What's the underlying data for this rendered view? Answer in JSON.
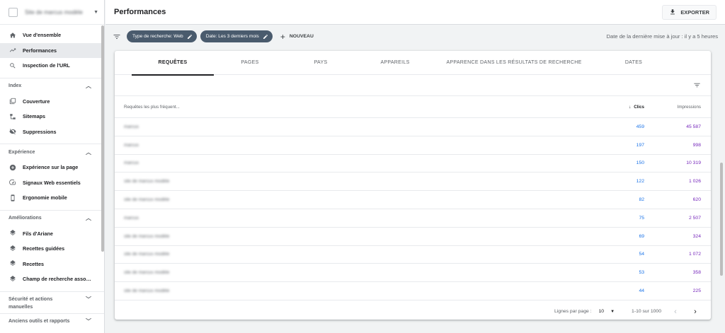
{
  "sidebar": {
    "property": "Site de marcus modèle",
    "nav": [
      {
        "label": "Vue d'ensemble",
        "icon": "home-icon"
      },
      {
        "label": "Performances",
        "icon": "trending-icon"
      },
      {
        "label": "Inspection de l'URL",
        "icon": "search-icon"
      }
    ],
    "sections": [
      {
        "title": "Index",
        "items": [
          {
            "label": "Couverture",
            "icon": "coverage-icon"
          },
          {
            "label": "Sitemaps",
            "icon": "sitemap-icon"
          },
          {
            "label": "Suppressions",
            "icon": "eye-off-icon"
          }
        ]
      },
      {
        "title": "Expérience",
        "items": [
          {
            "label": "Expérience sur la page",
            "icon": "plus-circle-icon"
          },
          {
            "label": "Signaux Web essentiels",
            "icon": "speed-icon"
          },
          {
            "label": "Ergonomie mobile",
            "icon": "phone-icon"
          }
        ]
      },
      {
        "title": "Améliorations",
        "items": [
          {
            "label": "Fils d'Ariane",
            "icon": "layers-icon"
          },
          {
            "label": "Recettes guidées",
            "icon": "layers-icon"
          },
          {
            "label": "Recettes",
            "icon": "layers-icon"
          },
          {
            "label": "Champ de recherche associé aux liens sitelink",
            "icon": "layers-icon"
          }
        ]
      },
      {
        "title": "Sécurité et actions manuelles"
      },
      {
        "title": "Anciens outils et rapports"
      }
    ]
  },
  "header": {
    "title": "Performances",
    "export_label": "EXPORTER"
  },
  "filters": {
    "chips": [
      "Type de recherche: Web",
      "Date: Les 3 derniers mois"
    ],
    "new_label": "NOUVEAU",
    "last_update": "Date de la dernière mise à jour : il y a 5 heures"
  },
  "tabs": [
    "REQUÊTES",
    "PAGES",
    "PAYS",
    "APPAREILS",
    "APPARENCE DANS LES RÉSULTATS DE RECHERCHE",
    "DATES"
  ],
  "table": {
    "headers": {
      "query": "Requêtes les plus fréquent...",
      "clicks": "Clics",
      "impressions": "Impressions"
    },
    "rows": [
      {
        "query": "marcus",
        "clicks": "459",
        "impressions": "45 587"
      },
      {
        "query": "marcus",
        "clicks": "197",
        "impressions": "998"
      },
      {
        "query": "marcus",
        "clicks": "150",
        "impressions": "10 319"
      },
      {
        "query": "site de marcus modèle",
        "clicks": "122",
        "impressions": "1 026"
      },
      {
        "query": "site de marcus modèle",
        "clicks": "82",
        "impressions": "620"
      },
      {
        "query": "marcus",
        "clicks": "75",
        "impressions": "2 507"
      },
      {
        "query": "site de marcus modèle",
        "clicks": "69",
        "impressions": "324"
      },
      {
        "query": "site de marcus modèle",
        "clicks": "54",
        "impressions": "1 072"
      },
      {
        "query": "site de marcus modèle",
        "clicks": "53",
        "impressions": "358"
      },
      {
        "query": "site de marcus modèle",
        "clicks": "44",
        "impressions": "225"
      }
    ]
  },
  "pagination": {
    "rows_label": "Lignes par page :",
    "rows_value": "10",
    "range": "1-10 sur 1000"
  }
}
